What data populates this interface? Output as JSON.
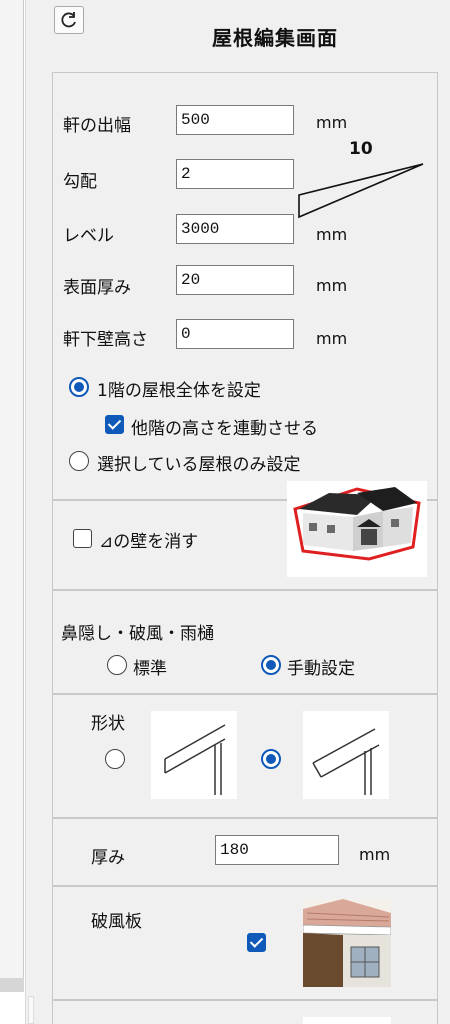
{
  "title": "屋根編集画面",
  "eave": {
    "label": "軒の出幅",
    "value": "500",
    "unit": "mm"
  },
  "slope": {
    "label": "勾配",
    "value": "2",
    "diagram_run": "10"
  },
  "level": {
    "label": "レベル",
    "value": "3000",
    "unit": "mm"
  },
  "thickness_surface": {
    "label": "表面厚み",
    "value": "20",
    "unit": "mm"
  },
  "eave_wall_height": {
    "label": "軒下壁高さ",
    "value": "0",
    "unit": "mm"
  },
  "scope": {
    "option_all": "1階の屋根全体を設定",
    "link_other_floors": "他階の高さを連動させる",
    "option_selected": "選択している屋根のみ設定",
    "selected": "all",
    "link_checked": true
  },
  "hide_wall": {
    "label": "⊿の壁を消す",
    "checked": false
  },
  "fascia": {
    "heading": "鼻隠し・破風・雨樋",
    "option_standard": "標準",
    "option_manual": "手動設定",
    "selected": "manual"
  },
  "shape": {
    "label": "形状",
    "selected": 2
  },
  "fascia_thickness": {
    "label": "厚み",
    "value": "180",
    "unit": "mm"
  },
  "barge_board": {
    "label": "破風板",
    "checked": true
  },
  "colors": {
    "accent": "#0f5ab8",
    "panel_border": "#c8c8c8",
    "house_outline": "#e02020"
  }
}
